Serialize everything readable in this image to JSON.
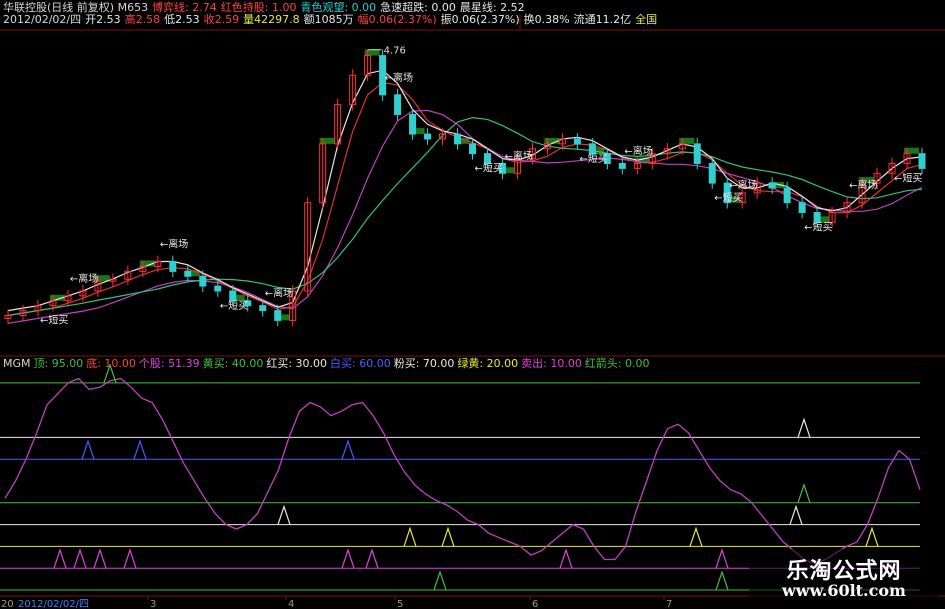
{
  "header": {
    "line1": [
      {
        "text": "华联控股(日线 前复权) M653",
        "color": "#d8d8d8"
      },
      {
        "text": "博弈线: 2.74",
        "color": "#ff4040"
      },
      {
        "text": "红色持股: 1.00",
        "color": "#ff4040"
      },
      {
        "text": "青色观望: 0.00",
        "color": "#20d0d0"
      },
      {
        "text": "急速超跌: 0.00",
        "color": "#e8e8e8"
      },
      {
        "text": "晨星线: 2.52",
        "color": "#e8e8e8"
      }
    ],
    "line2": [
      {
        "text": "2012/02/02/四",
        "color": "#d8d8d8"
      },
      {
        "text": "开2.53",
        "color": "#e8e8e8"
      },
      {
        "text": "高2.58",
        "color": "#ff4040"
      },
      {
        "text": "低2.53",
        "color": "#e8e8e8"
      },
      {
        "text": "收2.59",
        "color": "#ff4040"
      },
      {
        "text": "量42297.8",
        "color": "#e8e838"
      },
      {
        "text": "额1085万",
        "color": "#e8e8e8"
      },
      {
        "text": "幅0.06(2.37%)",
        "color": "#ff4040"
      },
      {
        "text": "振0.06(2.37%)",
        "color": "#e8e8e8"
      },
      {
        "text": "换0.38%",
        "color": "#e8e8e8"
      },
      {
        "text": "流通11.2亿",
        "color": "#e8e8e8"
      },
      {
        "text": "全国",
        "color": "#e8e838"
      }
    ]
  },
  "indicator_header": [
    {
      "text": "MGM",
      "color": "#d8d8d8"
    },
    {
      "text": "顶: 95.00",
      "color": "#40c040"
    },
    {
      "text": "底: 10.00",
      "color": "#ff4040"
    },
    {
      "text": "个股: 51.39",
      "color": "#e040e0"
    },
    {
      "text": "黄买: 40.00",
      "color": "#40c040"
    },
    {
      "text": "红买: 30.00",
      "color": "#e8e8e8"
    },
    {
      "text": "白买: 60.00",
      "color": "#4060ff"
    },
    {
      "text": "粉买: 70.00",
      "color": "#e8e8e8"
    },
    {
      "text": "绿黄: 20.00",
      "color": "#e8e838"
    },
    {
      "text": "卖出: 10.00",
      "color": "#e040e0"
    },
    {
      "text": "红箭头: 0.00",
      "color": "#40c040"
    }
  ],
  "price_labels": {
    "high_value": "4.76",
    "escape_label": "离场",
    "buy_label": "短买",
    "buy_label_alt": "短买",
    "escape_label_alt": "逃场"
  },
  "x_axis": {
    "date": "2012/02/02/四",
    "ticks": [
      "3",
      "4",
      "5",
      "6",
      "7"
    ],
    "left_num": "20"
  },
  "watermark": {
    "title": "乐淘公式网",
    "url": "www.60lt.com"
  },
  "chart_data": [
    {
      "type": "candlestick",
      "title": "华联控股(日线 前复权)",
      "high": 4.76,
      "series_close": [
        2.05,
        2.1,
        2.15,
        2.2,
        2.25,
        2.3,
        2.4,
        2.42,
        2.5,
        2.55,
        2.6,
        2.5,
        2.45,
        2.35,
        2.3,
        2.2,
        2.15,
        2.1,
        2.0,
        2.3,
        3.2,
        3.8,
        4.2,
        4.5,
        4.7,
        4.3,
        4.1,
        3.9,
        3.85,
        3.9,
        3.8,
        3.7,
        3.6,
        3.5,
        3.65,
        3.75,
        3.8,
        3.85,
        3.8,
        3.7,
        3.6,
        3.55,
        3.6,
        3.7,
        3.75,
        3.8,
        3.6,
        3.4,
        3.2,
        3.3,
        3.4,
        3.35,
        3.2,
        3.1,
        3.0,
        3.1,
        3.2,
        3.4,
        3.5,
        3.6,
        3.7,
        3.55
      ],
      "overlay_lines": [
        "博弈线",
        "红色持股",
        "青色观望",
        "晨星线"
      ]
    },
    {
      "type": "line",
      "title": "MGM",
      "ylim": [
        0,
        100
      ],
      "levels": [
        {
          "name": "顶",
          "value": 95,
          "color": "#40c040"
        },
        {
          "name": "白买",
          "value": 60,
          "color": "#4060ff"
        },
        {
          "name": "粉买",
          "value": 70,
          "color": "#e8e8e8"
        },
        {
          "name": "黄买",
          "value": 40,
          "color": "#40c040"
        },
        {
          "name": "红买",
          "value": 30,
          "color": "#e8e8e8"
        },
        {
          "name": "绿黄",
          "value": 20,
          "color": "#e8e838"
        },
        {
          "name": "卖出",
          "value": 10,
          "color": "#e040e0"
        },
        {
          "name": "红箭头",
          "value": 0,
          "color": "#40c040"
        }
      ],
      "series": [
        {
          "name": "个股",
          "color": "#c040c0",
          "values": [
            42,
            50,
            60,
            72,
            85,
            90,
            95,
            97,
            92,
            93,
            96,
            97,
            93,
            88,
            86,
            78,
            68,
            58,
            50,
            42,
            35,
            30,
            28,
            30,
            35,
            45,
            55,
            70,
            82,
            86,
            84,
            80,
            82,
            85,
            86,
            80,
            72,
            62,
            54,
            48,
            44,
            41,
            39,
            36,
            32,
            30,
            26,
            24,
            22,
            20,
            16,
            18,
            22,
            26,
            30,
            28,
            20,
            14,
            14,
            20,
            36,
            50,
            64,
            74,
            76,
            72,
            64,
            56,
            50,
            46,
            44,
            40,
            34,
            28,
            22,
            18,
            14,
            12,
            14,
            17,
            20,
            22,
            30,
            42,
            56,
            64,
            60,
            46
          ]
        }
      ]
    }
  ]
}
